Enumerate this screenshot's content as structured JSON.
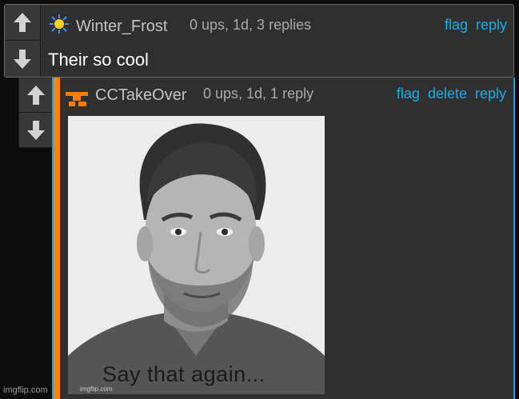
{
  "comment1": {
    "username": "Winter_Frost",
    "meta": "0 ups, 1d, 3 replies",
    "actions": [
      "flag",
      "reply"
    ],
    "text": "Their so cool"
  },
  "comment2": {
    "username": "CCTakeOver",
    "meta": "0 ups, 1d, 1 reply",
    "actions": [
      "flag",
      "delete",
      "reply"
    ],
    "image_caption": "Say that again...",
    "image_watermark": "imgflip.com"
  },
  "footer_watermark": "imgflip.com",
  "colors": {
    "accent": "#17aee6",
    "thread_stripe": "#ff8400",
    "panel": "#2f2f2f"
  }
}
